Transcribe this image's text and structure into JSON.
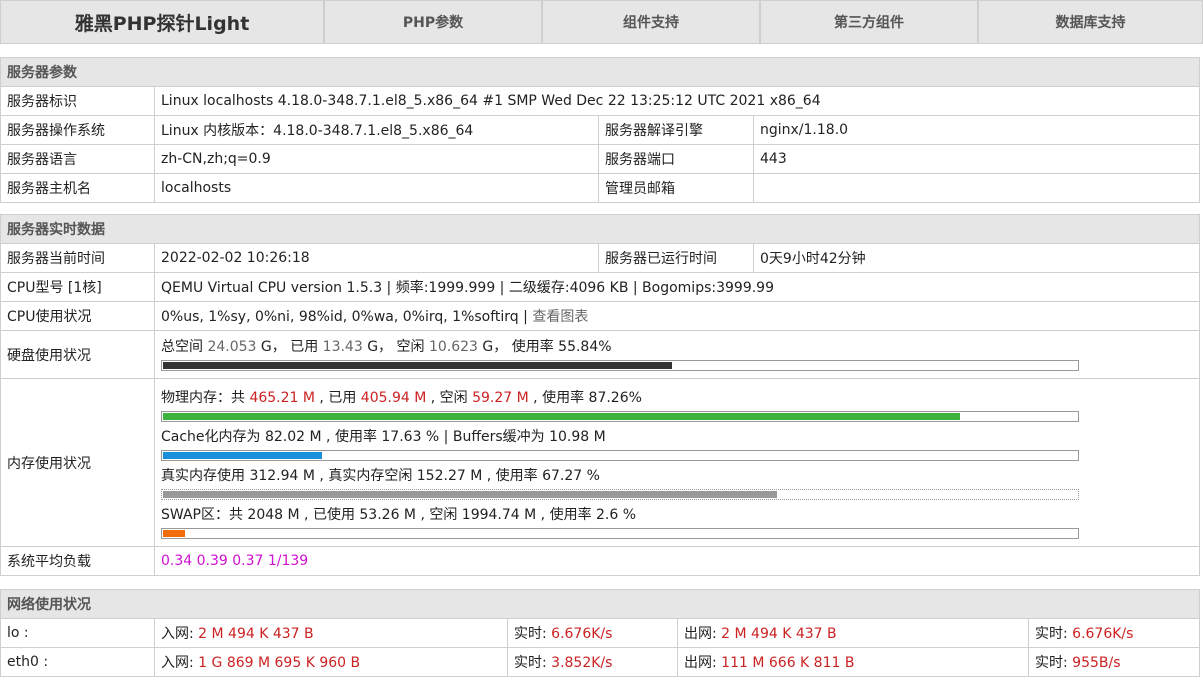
{
  "nav": {
    "brand": "雅黑PHP探针Light",
    "tabs": [
      "PHP参数",
      "组件支持",
      "第三方组件",
      "数据库支持"
    ]
  },
  "server_params": {
    "heading": "服务器参数",
    "id_label": "服务器标识",
    "id_value": "Linux localhosts 4.18.0-348.7.1.el8_5.x86_64 #1 SMP Wed Dec 22 13:25:12 UTC 2021 x86_64",
    "os_label": "服务器操作系统",
    "os_value": "Linux  内核版本：4.18.0-348.7.1.el8_5.x86_64",
    "engine_label": "服务器解译引擎",
    "engine_value": "nginx/1.18.0",
    "lang_label": "服务器语言",
    "lang_value": "zh-CN,zh;q=0.9",
    "port_label": "服务器端口",
    "port_value": "443",
    "host_label": "服务器主机名",
    "host_value": "localhosts",
    "email_label": "管理员邮箱",
    "email_value": ""
  },
  "realtime": {
    "heading": "服务器实时数据",
    "time_label": "服务器当前时间",
    "time_value": "2022-02-02 10:26:18",
    "uptime_label": "服务器已运行时间",
    "uptime_value": "0天9小时42分钟",
    "cpu_label": "CPU型号 [1核]",
    "cpu_value": "QEMU Virtual CPU version 1.5.3 | 频率:1999.999 | 二级缓存:4096 KB | Bogomips:3999.99",
    "cpu_usage_label": "CPU使用状况",
    "cpu_usage_value": "0%us, 1%sy, 0%ni, 98%id, 0%wa, 0%irq, 1%softirq",
    "cpu_usage_sep": " | ",
    "cpu_chart_link": "查看图表",
    "disk_label": "硬盘使用状况",
    "disk": {
      "t1": "总空间 ",
      "total": "24.053",
      "t2": " G， 已用 ",
      "used": "13.43",
      "t3": " G， 空闲 ",
      "free": "10.623",
      "t4": " G， 使用率 ",
      "rate": "55.84%",
      "fill": 0.5584
    },
    "mem_label": "内存使用状况",
    "physical": {
      "t1": "物理内存：共 ",
      "total": "465.21 M",
      "t2": " , 已用 ",
      "used": "405.94 M",
      "t3": " , 空闲 ",
      "free": "59.27 M",
      "t4": " , 使用率 ",
      "rate": "87.26%",
      "fill": 0.8726
    },
    "cache": {
      "text": "Cache化内存为 82.02 M , 使用率 17.63 % | Buffers缓冲为 10.98 M",
      "fill": 0.1763
    },
    "real": {
      "text": "真实内存使用 312.94 M , 真实内存空闲 152.27 M , 使用率 67.27 %",
      "fill": 0.6727
    },
    "swap": {
      "text": "SWAP区：共 2048 M , 已使用 53.26 M , 空闲 1994.74 M , 使用率 2.6 %",
      "fill": 0.026
    },
    "load_label": "系统平均负载",
    "load_value": "0.34 0.39 0.37 1/139"
  },
  "network": {
    "heading": "网络使用状况",
    "in_label": "入网: ",
    "out_label": "出网: ",
    "rt_label": "实时: ",
    "rows": [
      {
        "iface": "lo :",
        "in": "2 M 494 K 437 B",
        "in_rt": "6.676K/s",
        "out": "2 M 494 K 437 B",
        "out_rt": "6.676K/s"
      },
      {
        "iface": "eth0 :",
        "in": "1 G 869 M 695 K 960 B",
        "in_rt": "3.852K/s",
        "out": "111 M 666 K 811 B",
        "out_rt": "955B/s"
      }
    ]
  },
  "colors": {
    "header_bg": "#e6e6e6",
    "highlight_red": "#cc2222",
    "load_magenta": "#d010d0",
    "mem_green": "#3db33d",
    "cache_blue": "#1a8fdc",
    "swap_orange": "#f06c0c"
  }
}
